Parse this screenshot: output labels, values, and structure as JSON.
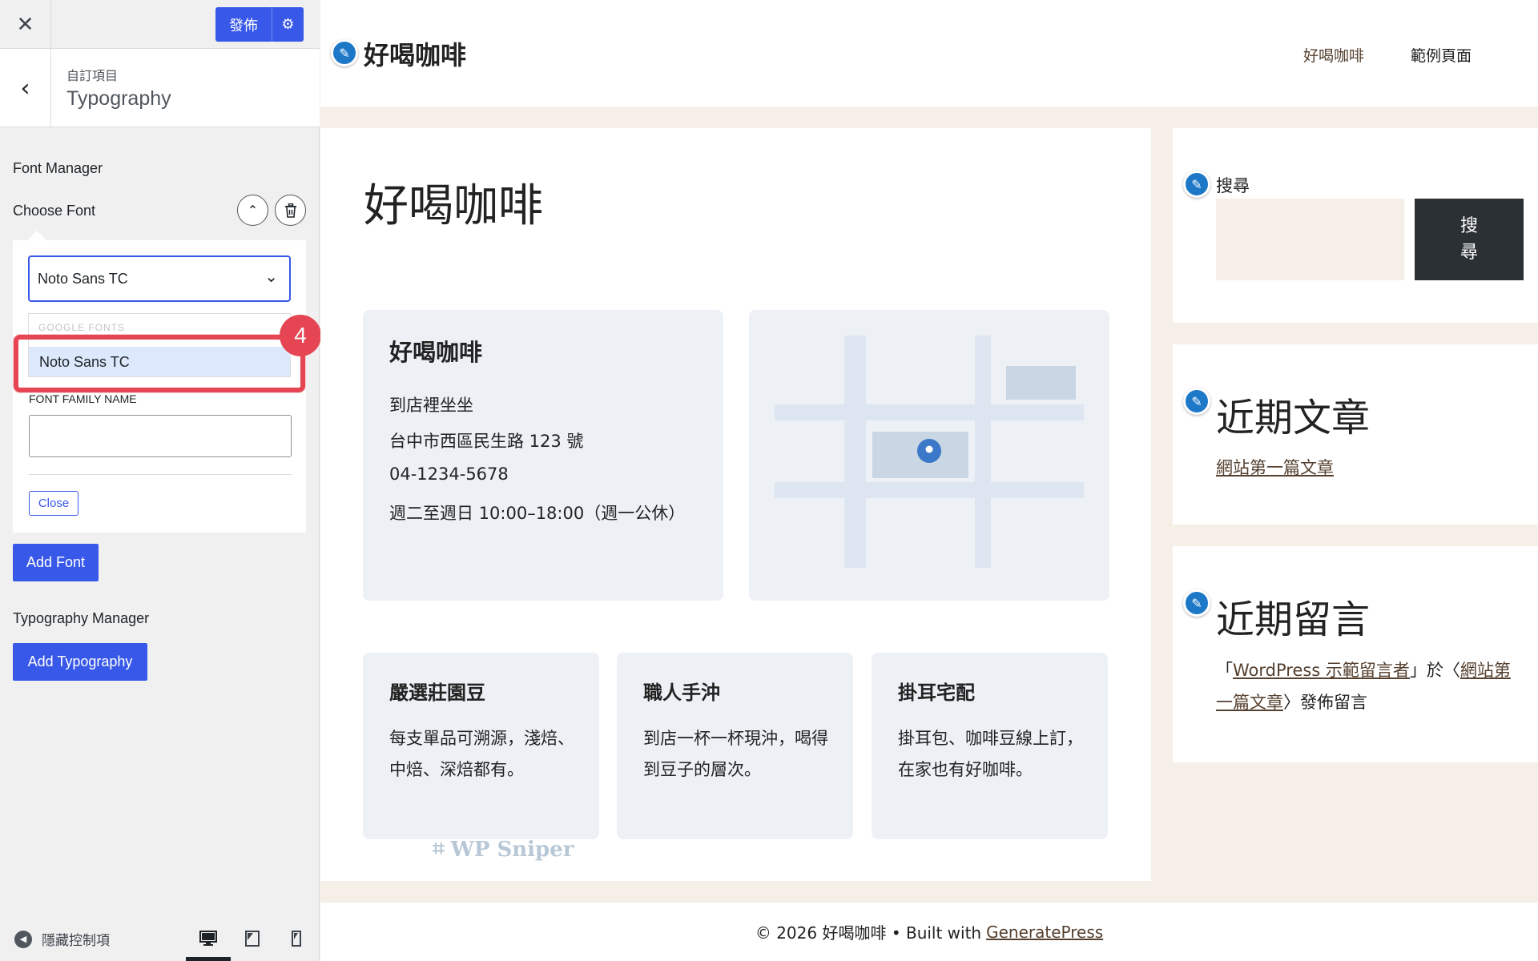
{
  "customizer": {
    "publish_label": "發佈",
    "breadcrumb": "自訂項目",
    "section_title": "Typography",
    "font_manager_label": "Font Manager",
    "choose_font_label": "Choose Font",
    "selected_font": "Noto Sans TC",
    "dropdown_group": "GOOGLE FONTS",
    "dropdown_option": "Noto Sans TC",
    "font_family_name_label": "FONT FAMILY NAME",
    "font_family_name_value": "",
    "close_label": "Close",
    "add_font_label": "Add Font",
    "typography_manager_label": "Typography Manager",
    "add_typography_label": "Add Typography",
    "hide_controls_label": "隱藏控制項",
    "step_number": "4"
  },
  "site": {
    "title": "好喝咖啡",
    "nav": [
      "好喝咖啡",
      "範例頁面"
    ],
    "page_title": "好喝咖啡",
    "info": {
      "heading": "好喝咖啡",
      "lines": [
        "到店裡坐坐",
        "台中市西區民生路 123 號",
        "04-1234-5678",
        "週二至週日 10:00–18:00（週一公休）"
      ]
    },
    "features": [
      {
        "title": "嚴選莊園豆",
        "text": "每支單品可溯源，淺焙、中焙、深焙都有。"
      },
      {
        "title": "職人手沖",
        "text": "到店一杯一杯現沖，喝得到豆子的層次。"
      },
      {
        "title": "掛耳宅配",
        "text": "掛耳包、咖啡豆線上訂，在家也有好咖啡。"
      }
    ],
    "watermark": "WP Sniper",
    "search_widget_title": "搜尋",
    "search_button_label": "搜尋",
    "recent_posts_title": "近期文章",
    "recent_post_link": "網站第一篇文章",
    "recent_comments_title": "近期留言",
    "comment": {
      "open_quote": "「",
      "author": "WordPress 示範留言者",
      "mid": "」於〈",
      "post": "網站第一篇文章",
      "tail": "〉發佈留言"
    },
    "footer_text": "© 2026 好喝咖啡 • Built with",
    "footer_link": "GeneratePress"
  },
  "colors": {
    "accent_blue": "#3858e9",
    "highlight_red": "#e64553",
    "site_bg": "#f6efe7",
    "card_bg": "#edf1f6",
    "link_brown": "#55402f"
  }
}
